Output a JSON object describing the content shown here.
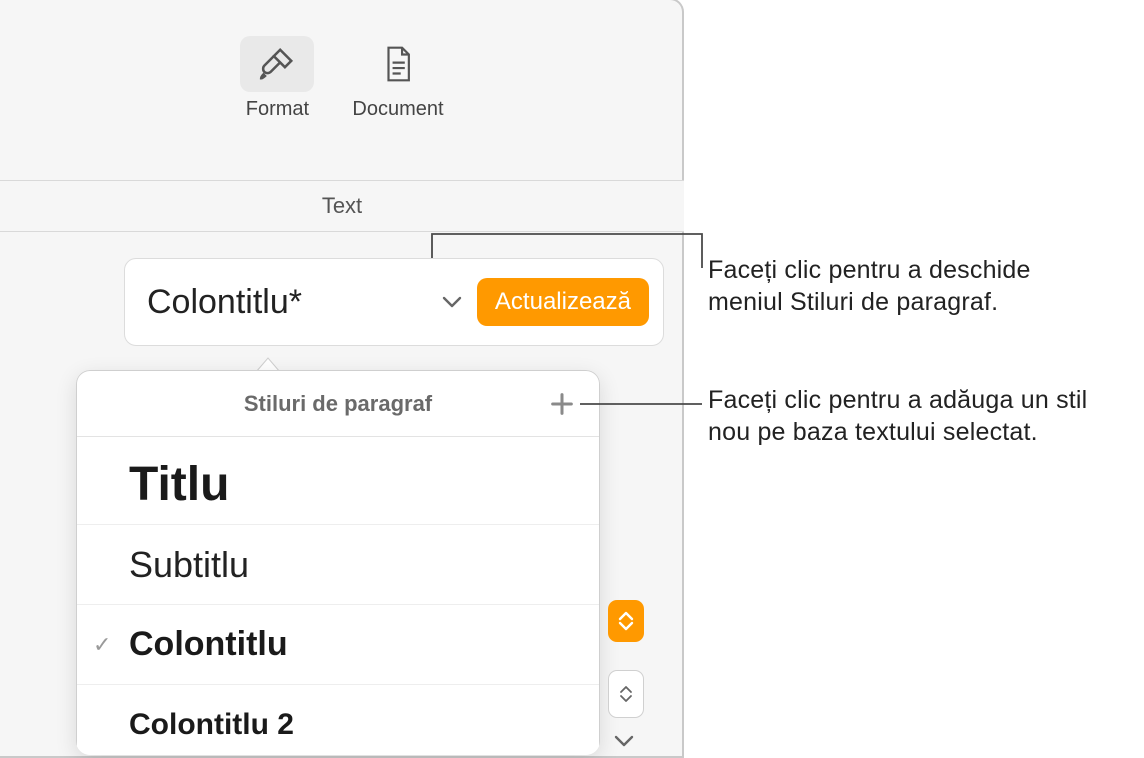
{
  "toolbar": {
    "format_label": "Format",
    "document_label": "Document"
  },
  "tab": {
    "text_label": "Text"
  },
  "style_control": {
    "current_style": "Colontitlu*",
    "update_button": "Actualizează"
  },
  "popover": {
    "title": "Stiluri de paragraf",
    "items": [
      {
        "label": "Titlu",
        "checked": false,
        "class": "s-titlu"
      },
      {
        "label": "Subtitlu",
        "checked": false,
        "class": "s-subtitlu"
      },
      {
        "label": "Colontitlu",
        "checked": true,
        "class": "s-colontitlu"
      },
      {
        "label": "Colontitlu 2",
        "checked": false,
        "class": "s-colontitlu2"
      }
    ]
  },
  "callouts": {
    "c1_line1": "Faceți clic pentru a deschide",
    "c1_line2": "meniul Stiluri de paragraf.",
    "c2_line1": "Faceți clic pentru a adăuga un stil",
    "c2_line2": "nou pe baza textului selectat."
  }
}
